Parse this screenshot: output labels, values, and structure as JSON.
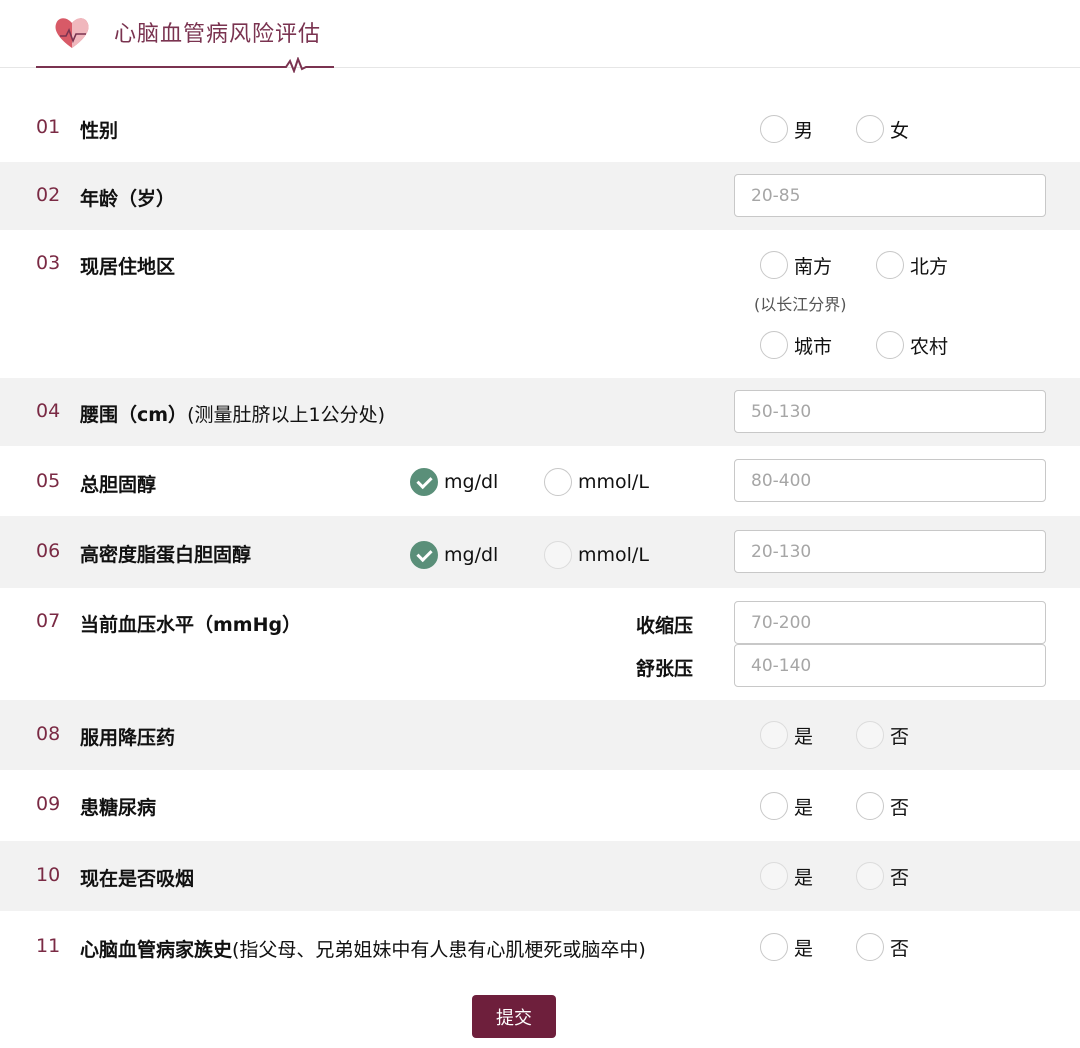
{
  "header": {
    "title": "心脑血管病风险评估"
  },
  "q1": {
    "num": "01",
    "label": "性别",
    "options": [
      "男",
      "女"
    ]
  },
  "q2": {
    "num": "02",
    "label": "年龄（岁）",
    "placeholder": "20-85"
  },
  "q3": {
    "num": "03",
    "label": "现居住地区",
    "options_region": [
      "南方",
      "北方"
    ],
    "note": "(以长江分界)",
    "options_area": [
      "城市",
      "农村"
    ]
  },
  "q4": {
    "num": "04",
    "label": "腰围（cm）",
    "sub": "(测量肚脐以上1公分处)",
    "placeholder": "50-130"
  },
  "q5": {
    "num": "05",
    "label": "总胆固醇",
    "units": [
      "mg/dl",
      "mmol/L"
    ],
    "selected_unit": "mg/dl",
    "placeholder": "80-400"
  },
  "q6": {
    "num": "06",
    "label": "高密度脂蛋白胆固醇",
    "units": [
      "mg/dl",
      "mmol/L"
    ],
    "selected_unit": "mg/dl",
    "placeholder": "20-130"
  },
  "q7": {
    "num": "07",
    "label": "当前血压水平（mmHg）",
    "systolic_label": "收缩压",
    "systolic_placeholder": "70-200",
    "diastolic_label": "舒张压",
    "diastolic_placeholder": "40-140"
  },
  "q8": {
    "num": "08",
    "label": "服用降压药",
    "options": [
      "是",
      "否"
    ]
  },
  "q9": {
    "num": "09",
    "label": "患糖尿病",
    "options": [
      "是",
      "否"
    ]
  },
  "q10": {
    "num": "10",
    "label": "现在是否吸烟",
    "options": [
      "是",
      "否"
    ]
  },
  "q11": {
    "num": "11",
    "label": "心脑血管病家族史",
    "sub": "(指父母、兄弟姐妹中有人患有心肌梗死或脑卒中)",
    "options": [
      "是",
      "否"
    ]
  },
  "submit": {
    "label": "提交"
  },
  "colors": {
    "accent": "#6e1f3c",
    "title": "#7a3350",
    "check": "#5a8f79",
    "row_alt": "#f2f2f2"
  }
}
